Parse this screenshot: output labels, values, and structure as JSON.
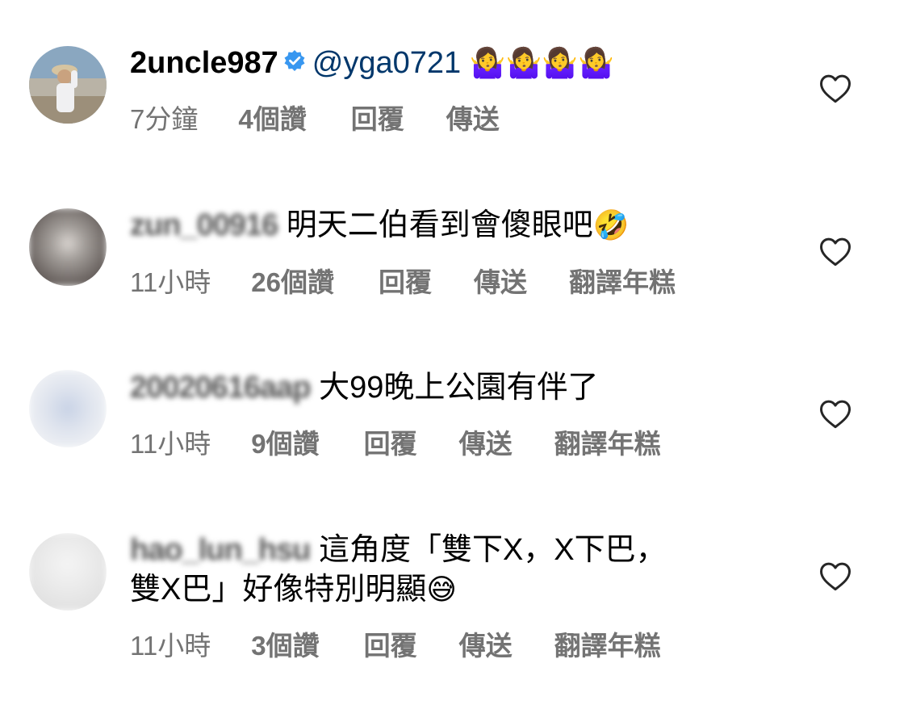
{
  "comments": [
    {
      "username": "2uncle987",
      "verified": true,
      "mention": "@yga0721",
      "text": "",
      "emojis": "🤷‍♀️🤷‍♀️🤷‍♀️🤷‍♀️",
      "time": "7分鐘",
      "likes": "4個讚",
      "reply": "回覆",
      "send": "傳送",
      "translate": ""
    },
    {
      "username": "zun_00916",
      "text": "明天二伯看到會傻眼吧",
      "emojis": "🤣",
      "time": "11小時",
      "likes": "26個讚",
      "reply": "回覆",
      "send": "傳送",
      "translate": "翻譯年糕"
    },
    {
      "username": "20020616aap",
      "text": "大99晚上公園有伴了",
      "emojis": "",
      "time": "11小時",
      "likes": "9個讚",
      "reply": "回覆",
      "send": "傳送",
      "translate": "翻譯年糕"
    },
    {
      "username": "hao_lun_hsu",
      "text": "這角度「雙下X，X下巴，",
      "text_line2": "雙X巴」好像特別明顯",
      "emojis": "😅",
      "time": "11小時",
      "likes": "3個讚",
      "reply": "回覆",
      "send": "傳送",
      "translate": "翻譯年糕"
    }
  ],
  "icons": {
    "like": "heart-outline-icon",
    "verified": "verified-badge-icon"
  },
  "colors": {
    "mention": "#00376b",
    "meta": "#737373",
    "verified": "#3897f0"
  }
}
